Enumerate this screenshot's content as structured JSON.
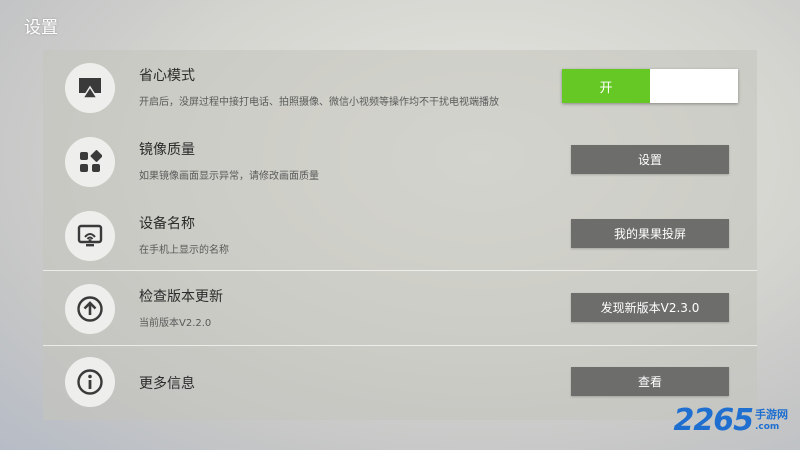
{
  "header": {
    "title": "设置"
  },
  "rows": [
    {
      "title": "省心模式",
      "desc": "开启后，没屏过程中接打电话、拍照摄像、微信小视频等操作均不干扰电视端播放",
      "icon": "airplay-icon",
      "control": {
        "type": "toggle",
        "on_label": "开"
      }
    },
    {
      "title": "镜像质量",
      "desc": "如果镜像画面显示异常，请修改画面质量",
      "icon": "apps-grid-icon",
      "control": {
        "type": "button",
        "label": "设置"
      }
    },
    {
      "title": "设备名称",
      "desc": "在手机上显示的名称",
      "icon": "cast-screen-icon",
      "control": {
        "type": "button",
        "label": "我的果果投屏"
      }
    },
    {
      "title": "检查版本更新",
      "desc": "当前版本V2.2.0",
      "icon": "upload-arrow-icon",
      "control": {
        "type": "button",
        "label": "发现新版本V2.3.0"
      }
    },
    {
      "title": "更多信息",
      "desc": "",
      "icon": "info-icon",
      "control": {
        "type": "button",
        "label": "查看"
      }
    }
  ],
  "watermark": {
    "number": "2265",
    "text": "手游网",
    "domain": ".com"
  },
  "colors": {
    "toggle_on": "#66c825",
    "button_bg": "#6d6d6b",
    "watermark": "#1f6fd0"
  }
}
